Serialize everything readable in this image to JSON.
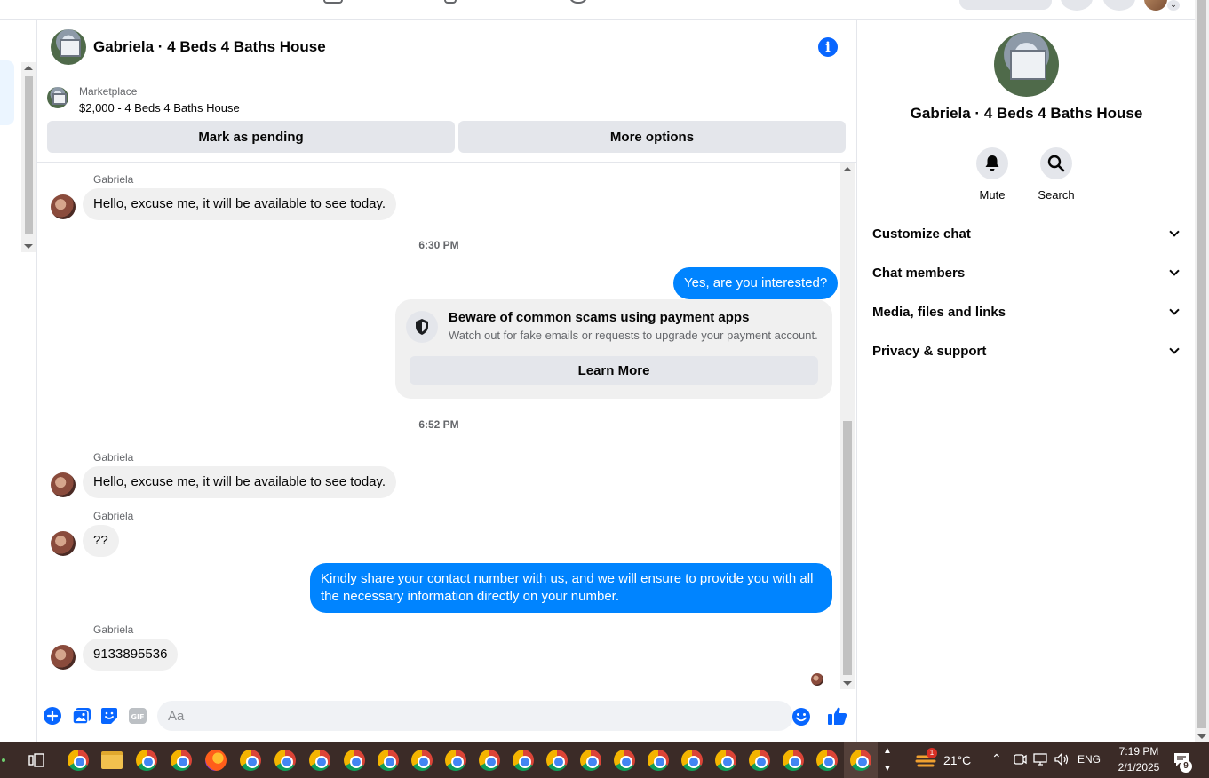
{
  "chat": {
    "title": "Gabriela · 4 Beds 4 Baths House",
    "marketplace_label": "Marketplace",
    "listing": "$2,000 - 4 Beds 4 Baths House",
    "mark_pending": "Mark as pending",
    "more_options": "More options"
  },
  "messages": {
    "sender": "Gabriela",
    "msg1": "Hello, excuse me, it will be available to see today.",
    "time1": "6:30 PM",
    "out1": "Yes, are you interested?",
    "scam_title": "Beware of common scams using payment apps",
    "scam_sub": "Watch out for fake emails or requests to upgrade your payment account.",
    "learn_more": "Learn More",
    "time2": "6:52 PM",
    "msg2": "Hello, excuse me, it will be available to see today.",
    "msg3": "??",
    "out2": "Kindly share your contact number with us, and we will ensure to provide you with all the necessary information directly on your number.",
    "msg4": "9133895536"
  },
  "composer": {
    "placeholder": "Aa"
  },
  "right_panel": {
    "name": "Gabriela · 4 Beds 4 Baths House",
    "mute": "Mute",
    "search": "Search",
    "rows": [
      "Customize chat",
      "Chat members",
      "Media, files and links",
      "Privacy & support"
    ]
  },
  "taskbar": {
    "weather": "21°C",
    "lang": "ENG",
    "time": "7:19 PM",
    "date": "2/1/2025",
    "notif_count": "9",
    "weather_badge": "1"
  },
  "colors": {
    "accent": "#0866ff",
    "outgoing_bubble": "#0084ff",
    "incoming_bubble": "#f0f0f0",
    "taskbar": "#3b2b27"
  }
}
